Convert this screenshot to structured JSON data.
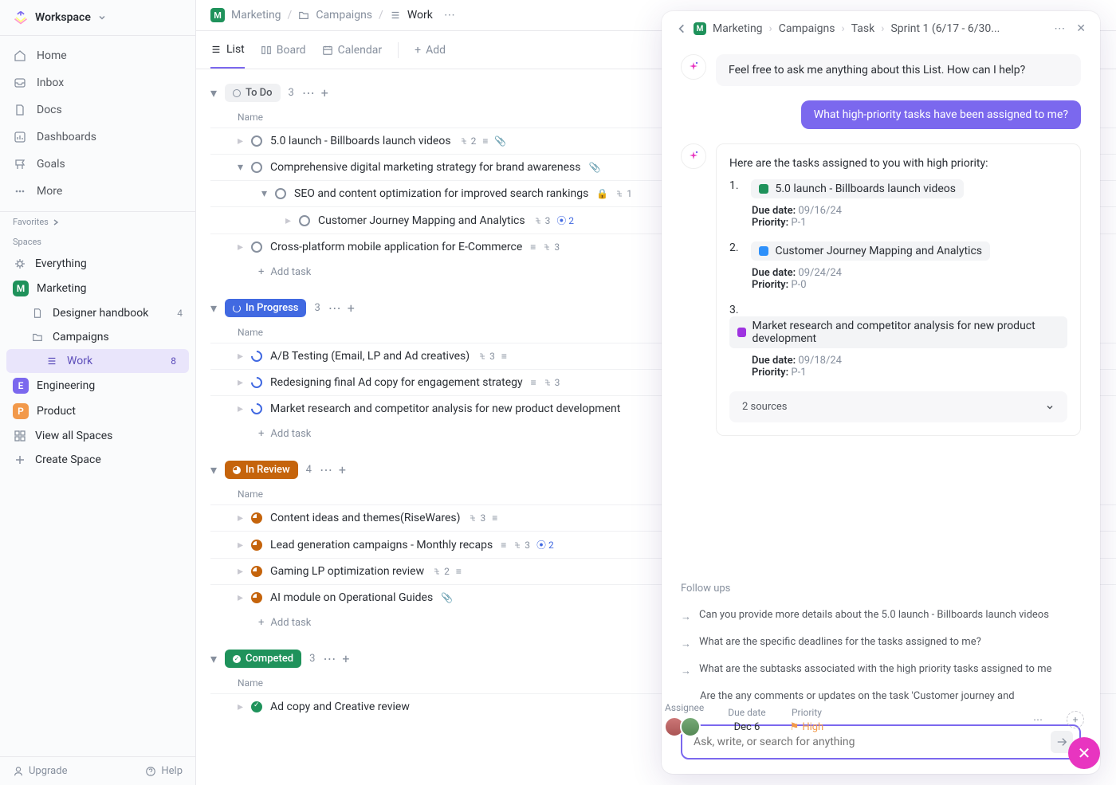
{
  "workspace": {
    "name": "Workspace"
  },
  "sidebar": {
    "nav": [
      {
        "label": "Home",
        "icon": "home"
      },
      {
        "label": "Inbox",
        "icon": "inbox"
      },
      {
        "label": "Docs",
        "icon": "doc"
      },
      {
        "label": "Dashboards",
        "icon": "dashboard"
      },
      {
        "label": "Goals",
        "icon": "goal"
      },
      {
        "label": "More",
        "icon": "more"
      }
    ],
    "favorites_label": "Favorites",
    "spaces_label": "Spaces",
    "everything_label": "Everything",
    "marketing": {
      "label": "Marketing",
      "badge": "M",
      "color": "#1f925b"
    },
    "designer_handbook": {
      "label": "Designer handbook",
      "count": "4"
    },
    "campaigns": {
      "label": "Campaigns"
    },
    "work": {
      "label": "Work",
      "count": "8"
    },
    "engineering": {
      "label": "Engineering",
      "badge": "E",
      "color": "#7b68ee"
    },
    "product": {
      "label": "Product",
      "badge": "P",
      "color": "#f2994a"
    },
    "view_all": "View all Spaces",
    "create_space": "Create Space",
    "upgrade": "Upgrade",
    "help": "Help"
  },
  "breadcrumbs": {
    "space": "Marketing",
    "folder": "Campaigns",
    "list": "Work"
  },
  "viewtabs": {
    "list": "List",
    "board": "Board",
    "calendar": "Calendar",
    "add": "Add"
  },
  "groups": {
    "name_col": "Name",
    "add_task": "Add task",
    "todo": {
      "label": "To Do",
      "count": "3",
      "tasks": [
        {
          "title": "5.0 launch - Billboards launch videos",
          "sub": "2",
          "attach": true
        },
        {
          "title": "Comprehensive digital marketing strategy for brand awareness",
          "attach": true
        },
        {
          "title": "SEO and content optimization for improved search rankings",
          "lock": true,
          "sub": "1",
          "indent": 1
        },
        {
          "title": "Customer Journey Mapping and Analytics",
          "sub": "3",
          "badge": "2",
          "indent": 2
        },
        {
          "title": "Cross-platform mobile application for E-Commerce",
          "sub": "3"
        }
      ]
    },
    "progress": {
      "label": "In Progress",
      "count": "3",
      "tasks": [
        {
          "title": "A/B Testing (Email, LP and Ad creatives)",
          "sub": "3"
        },
        {
          "title": "Redesigning final Ad copy for engagement strategy",
          "sub": "3"
        },
        {
          "title": "Market research and competitor analysis for new product development"
        }
      ]
    },
    "review": {
      "label": "In Review",
      "count": "4",
      "tasks": [
        {
          "title": "Content ideas and themes(RiseWares)",
          "sub": "3"
        },
        {
          "title": "Lead generation campaigns - Monthly recaps",
          "sub": "3",
          "badge": "2"
        },
        {
          "title": "Gaming LP optimization review",
          "sub": "2"
        },
        {
          "title": "AI module on Operational Guides",
          "attach": true
        }
      ]
    },
    "competed": {
      "label": "Competed",
      "count": "3",
      "tasks": [
        {
          "title": "Ad copy and Creative review"
        }
      ]
    }
  },
  "ai": {
    "crumbs": [
      "Marketing",
      "Campaigns",
      "Task",
      "Sprint 1 (6/17 - 6/30..."
    ],
    "greeting": "Feel free to ask me anything about this List. How can I help?",
    "user_msg": "What high-priority tasks have been assigned to me?",
    "response_intro": "Here are the tasks assigned to you with high priority:",
    "tasks": [
      {
        "num": "1.",
        "title": "5.0 launch - Billboards launch videos",
        "color": "#1f925b",
        "due": "09/16/24",
        "priority": "P-1"
      },
      {
        "num": "2.",
        "title": "Customer Journey Mapping and Analytics",
        "color": "#2e90fa",
        "due": "09/24/24",
        "priority": "P-0"
      },
      {
        "num": "3.",
        "title": "Market research and competitor analysis for new product development",
        "color": "#9e33e0",
        "due": "09/18/24",
        "priority": "P-1"
      }
    ],
    "due_label": "Due date:",
    "priority_label": "Priority:",
    "sources": "2 sources",
    "followups_label": "Follow ups",
    "followups": [
      "Can you provide more details about the 5.0 launch - Billboards launch videos",
      "What are the specific deadlines for the tasks assigned to me?",
      "What are the subtasks associated with the high priority tasks assigned to me",
      "Are the any comments or updates on the task 'Customer journey and"
    ],
    "input_placeholder": "Ask, write, or search for anything"
  },
  "strip": {
    "assignee": "Assignee",
    "due_date_label": "Due date",
    "due_date": "Dec 6",
    "priority_label": "Priority",
    "priority": "High"
  }
}
